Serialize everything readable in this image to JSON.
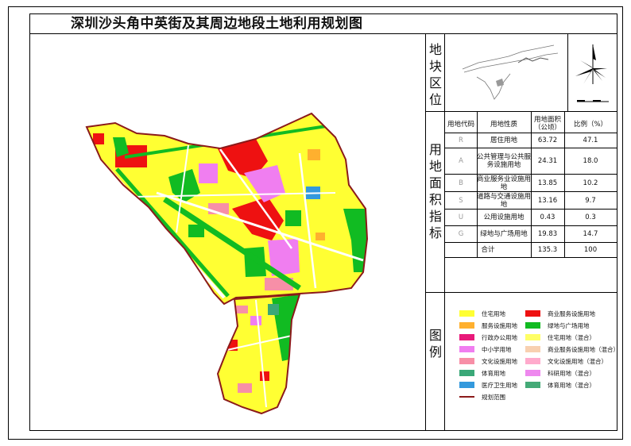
{
  "title": "深圳沙头角中英街及其周边地段土地利用规划图",
  "location_label": "地块区位",
  "land_index_label": "用地面积指标",
  "legend_label": "图例",
  "table": {
    "headers": [
      "用地代码",
      "用地性质",
      "用地面积（公顷）",
      "比例（%）"
    ],
    "rows": [
      {
        "code": "R",
        "name": "居住用地",
        "area": "63.72",
        "pct": "47.1"
      },
      {
        "code": "A",
        "name": "公共管理与公共服务设施用地",
        "area": "24.31",
        "pct": "18.0"
      },
      {
        "code": "B",
        "name": "商业服务业设施用地",
        "area": "13.85",
        "pct": "10.2"
      },
      {
        "code": "S",
        "name": "道路与交通设施用地",
        "area": "13.16",
        "pct": "9.7"
      },
      {
        "code": "U",
        "name": "公用设施用地",
        "area": "0.43",
        "pct": "0.3"
      },
      {
        "code": "G",
        "name": "绿地与广场用地",
        "area": "19.83",
        "pct": "14.7"
      }
    ],
    "total": {
      "label": "合计",
      "area": "135.3",
      "pct": "100"
    }
  },
  "legend": {
    "left": [
      {
        "label": "住宅用地",
        "color": "#ffff33"
      },
      {
        "label": "服务设施用地",
        "color": "#ffb02e"
      },
      {
        "label": "行政办公用地",
        "color": "#e8197a"
      },
      {
        "label": "中小学用地",
        "color": "#f07ef0"
      },
      {
        "label": "文化设施用地",
        "color": "#f78fa7"
      },
      {
        "label": "体育用地",
        "color": "#3aa878"
      },
      {
        "label": "医疗卫生用地",
        "color": "#3399dd"
      },
      {
        "label": "规划范围",
        "color": "#8b1a1a"
      }
    ],
    "right": [
      {
        "label": "商业服务设施用地",
        "color": "#ee1111"
      },
      {
        "label": "绿地与广场用地",
        "color": "#11bb22"
      },
      {
        "label": "住宅用地（混合）",
        "color": "#ffff66"
      },
      {
        "label": "商业服务设施用地（混合）",
        "color": "#f8d0b0"
      },
      {
        "label": "文化设施用地（混合）",
        "color": "#ffaacc"
      },
      {
        "label": "科研用地（混合）",
        "color": "#ee88ee"
      },
      {
        "label": "体育用地（混合）",
        "color": "#44aa77"
      }
    ]
  }
}
